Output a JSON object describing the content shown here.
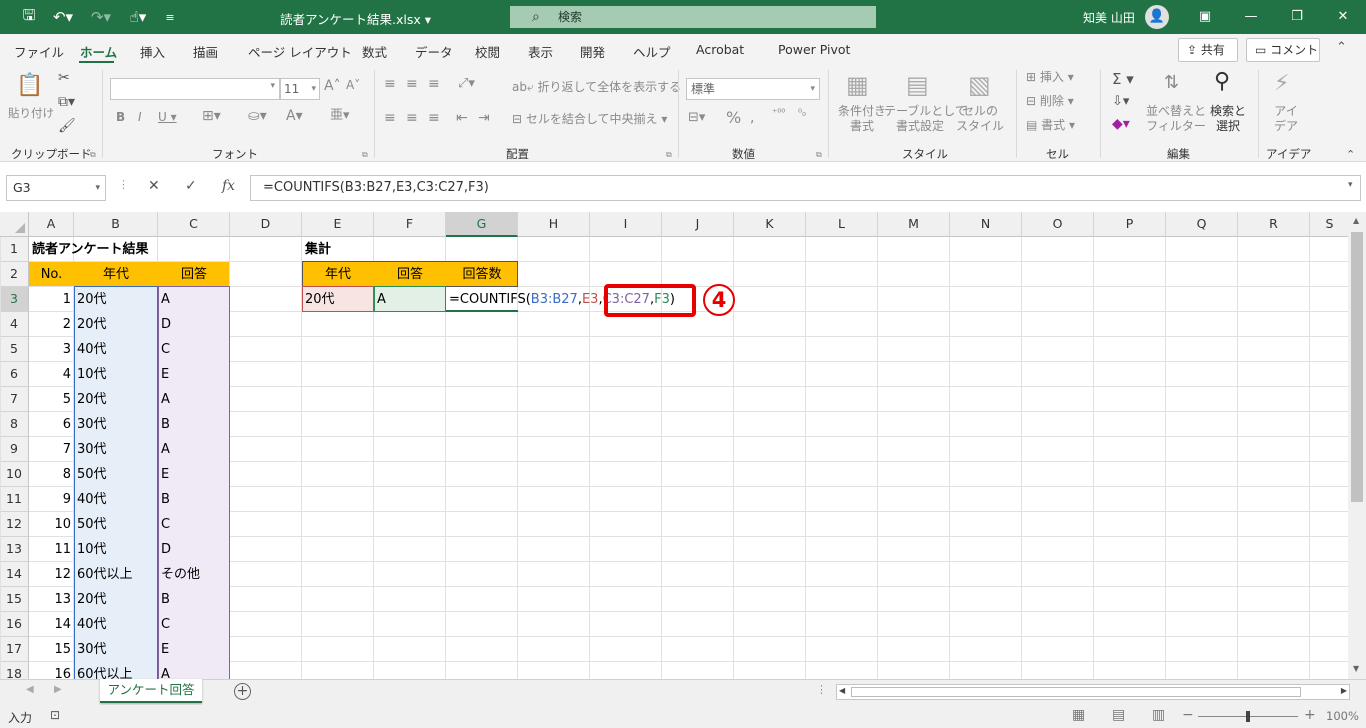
{
  "titlebar": {
    "filename": "読者アンケート結果.xlsx",
    "search_label": "検索",
    "user_name": "知美 山田"
  },
  "tabs": [
    "ファイル",
    "ホーム",
    "挿入",
    "描画",
    "ページ レイアウト",
    "数式",
    "データ",
    "校閲",
    "表示",
    "開発",
    "ヘルプ",
    "Acrobat",
    "Power Pivot"
  ],
  "share_label": "共有",
  "comment_label": "コメント",
  "ribbon": {
    "paste": "貼り付け",
    "clipboard": "クリップボード",
    "font_group": "フォント",
    "font_size": "11",
    "wrap": "折り返して全体を表示する",
    "merge": "セルを結合して中央揃え",
    "align_group": "配置",
    "number_format": "標準",
    "number_group": "数値",
    "cond_format": "条件付き\n書式",
    "table_format": "テーブルとして\n書式設定",
    "cell_style": "セルの\nスタイル",
    "style_group": "スタイル",
    "insert": "挿入",
    "delete": "削除",
    "format": "書式",
    "cell_group": "セル",
    "sort": "並べ替えと\nフィルター",
    "find": "検索と\n選択",
    "edit_group": "編集",
    "idea": "アイ\nデア",
    "idea_group": "アイデア"
  },
  "name_box": "G3",
  "formula": "=COUNTIFS(B3:B27,E3,C3:C27,F3)",
  "columns": [
    "A",
    "B",
    "C",
    "D",
    "E",
    "F",
    "G",
    "H",
    "I",
    "J",
    "K",
    "L",
    "M",
    "N",
    "O",
    "P",
    "Q",
    "R",
    "S"
  ],
  "rows": [
    "1",
    "2",
    "3",
    "4",
    "5",
    "6",
    "7",
    "8",
    "9",
    "10",
    "11",
    "12",
    "13",
    "14",
    "15",
    "16",
    "17",
    "18"
  ],
  "sheet": {
    "title": "読者アンケート結果",
    "headers": [
      "No.",
      "年代",
      "回答"
    ],
    "data": [
      [
        "1",
        "20代",
        "A"
      ],
      [
        "2",
        "20代",
        "D"
      ],
      [
        "3",
        "40代",
        "C"
      ],
      [
        "4",
        "10代",
        "E"
      ],
      [
        "5",
        "20代",
        "A"
      ],
      [
        "6",
        "30代",
        "B"
      ],
      [
        "7",
        "30代",
        "A"
      ],
      [
        "8",
        "50代",
        "E"
      ],
      [
        "9",
        "40代",
        "B"
      ],
      [
        "10",
        "50代",
        "C"
      ],
      [
        "11",
        "10代",
        "D"
      ],
      [
        "12",
        "60代以上",
        "その他"
      ],
      [
        "13",
        "20代",
        "B"
      ],
      [
        "14",
        "40代",
        "C"
      ],
      [
        "15",
        "30代",
        "E"
      ],
      [
        "16",
        "60代以上",
        "A"
      ]
    ],
    "summary_title": "集計",
    "summary_headers": [
      "年代",
      "回答",
      "回答数"
    ],
    "summary_row": [
      "20代",
      "A"
    ],
    "formula_parts": [
      "=COUNTIFS(",
      "B3:B27",
      ",",
      "E3",
      ",",
      "C3:C27",
      ",",
      "F3",
      ")"
    ]
  },
  "annotation": "4",
  "sheet_tab": "アンケート回答",
  "status": {
    "mode": "入力",
    "zoom": "100%"
  },
  "colors": {
    "accent": "#217346",
    "header_fill": "#ffc000",
    "red": "#e60000"
  }
}
